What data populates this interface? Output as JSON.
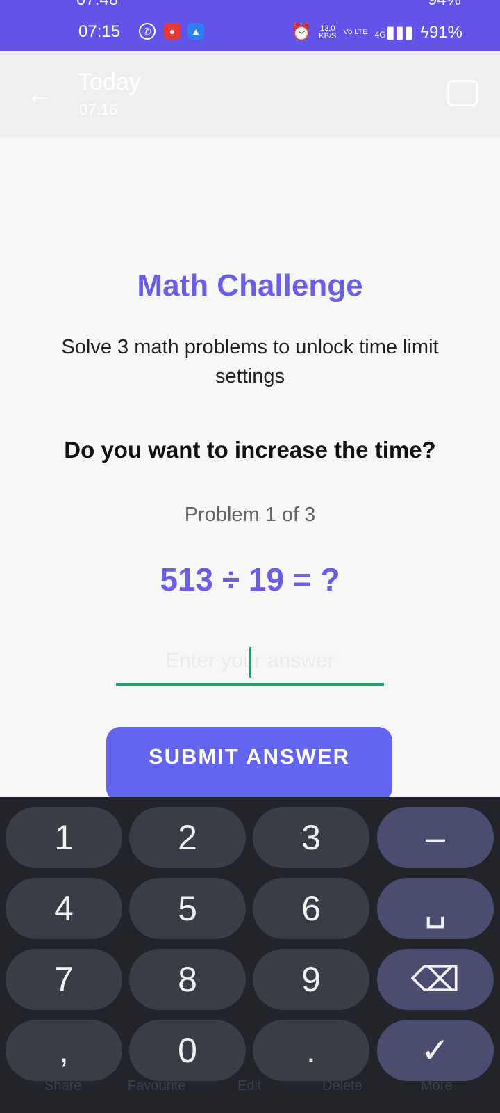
{
  "status_bar": {
    "ghost_time": "07:48",
    "ghost_battery": "94%",
    "time": "07:15",
    "speed_value": "13.0",
    "speed_unit": "KB/S",
    "volte": "Vo LTE",
    "network": "4G",
    "battery": "91%"
  },
  "background_header": {
    "title": "Today",
    "subtitle": "07:16"
  },
  "challenge": {
    "title": "Math Challenge",
    "subtitle": "Solve 3 math problems to unlock time limit settings",
    "question": "Do you want to increase the time?",
    "progress": "Problem 1 of 3",
    "problem": "513 ÷ 19 = ?",
    "answer_placeholder": "Enter your answer",
    "submit_label": "SUBMIT ANSWER"
  },
  "keyboard": {
    "keys": [
      "1",
      "2",
      "3",
      "–",
      "4",
      "5",
      "6",
      "␣",
      "7",
      "8",
      "9",
      "⌫",
      ",",
      "0",
      ".",
      "✓"
    ]
  },
  "background_footer": [
    "Share",
    "Favourite",
    "Edit",
    "Delete",
    "More"
  ]
}
